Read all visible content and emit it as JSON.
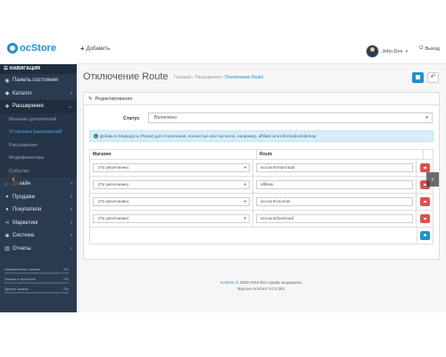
{
  "topbar": {
    "logo_text": "ocStore",
    "add_label": "Добавить",
    "user_name": "John Doe",
    "logout_label": "Выход"
  },
  "sidebar": {
    "header": "НАВИГАЦИЯ",
    "items": [
      {
        "label": "Панель состояния",
        "icon": "dashboard-icon"
      },
      {
        "label": "Каталог",
        "icon": "tag-icon"
      },
      {
        "label": "Расширения",
        "icon": "puzzle-icon",
        "active": true
      },
      {
        "label": "Дизайн",
        "icon": "desktop-icon"
      },
      {
        "label": "Продажи",
        "icon": "cart-icon"
      },
      {
        "label": "Покупатели",
        "icon": "user-icon"
      },
      {
        "label": "Маркетинг",
        "icon": "share-icon"
      },
      {
        "label": "Система",
        "icon": "gear-icon"
      },
      {
        "label": "Отчеты",
        "icon": "chart-icon"
      }
    ],
    "subitems": [
      "Магазин дополнений",
      "Установка расширений",
      "Расширения",
      "Модификаторы",
      "События"
    ],
    "stats": [
      {
        "label": "Завершенные заказы",
        "value": "0%"
      },
      {
        "label": "Заказы в процессе",
        "value": "0%"
      },
      {
        "label": "Другие заказы",
        "value": "0%"
      }
    ]
  },
  "page": {
    "title": "Отключение Route",
    "breadcrumb": [
      "Главная",
      "Расширения",
      "Отключение Route"
    ],
    "panel_title": "Редактирование",
    "status_label": "Статус",
    "status_value": "Включено",
    "alert_text": "Добавьте Маршруты (Route) для отключения, полностью или частично, например, affiliate или information/sitemap",
    "col_store": "Магазин",
    "col_route": "Route",
    "rows": [
      {
        "store": "(По умолчанию)",
        "route": "account/return/add"
      },
      {
        "store": "(По умолчанию)",
        "route": "affiliate"
      },
      {
        "store": "(По умолчанию)",
        "route": "account/voucher"
      },
      {
        "store": "(По умолчанию)",
        "route": "account/download"
      }
    ]
  },
  "footer": {
    "brand": "ocStore",
    "line1": "© 2009-2018 Все права защищены.",
    "line2": "Версия ocStore 3.0.2.0b1"
  },
  "colors": {
    "accent": "#1e91cf",
    "danger": "#d9534f",
    "sidebar": "#2a3b50"
  }
}
